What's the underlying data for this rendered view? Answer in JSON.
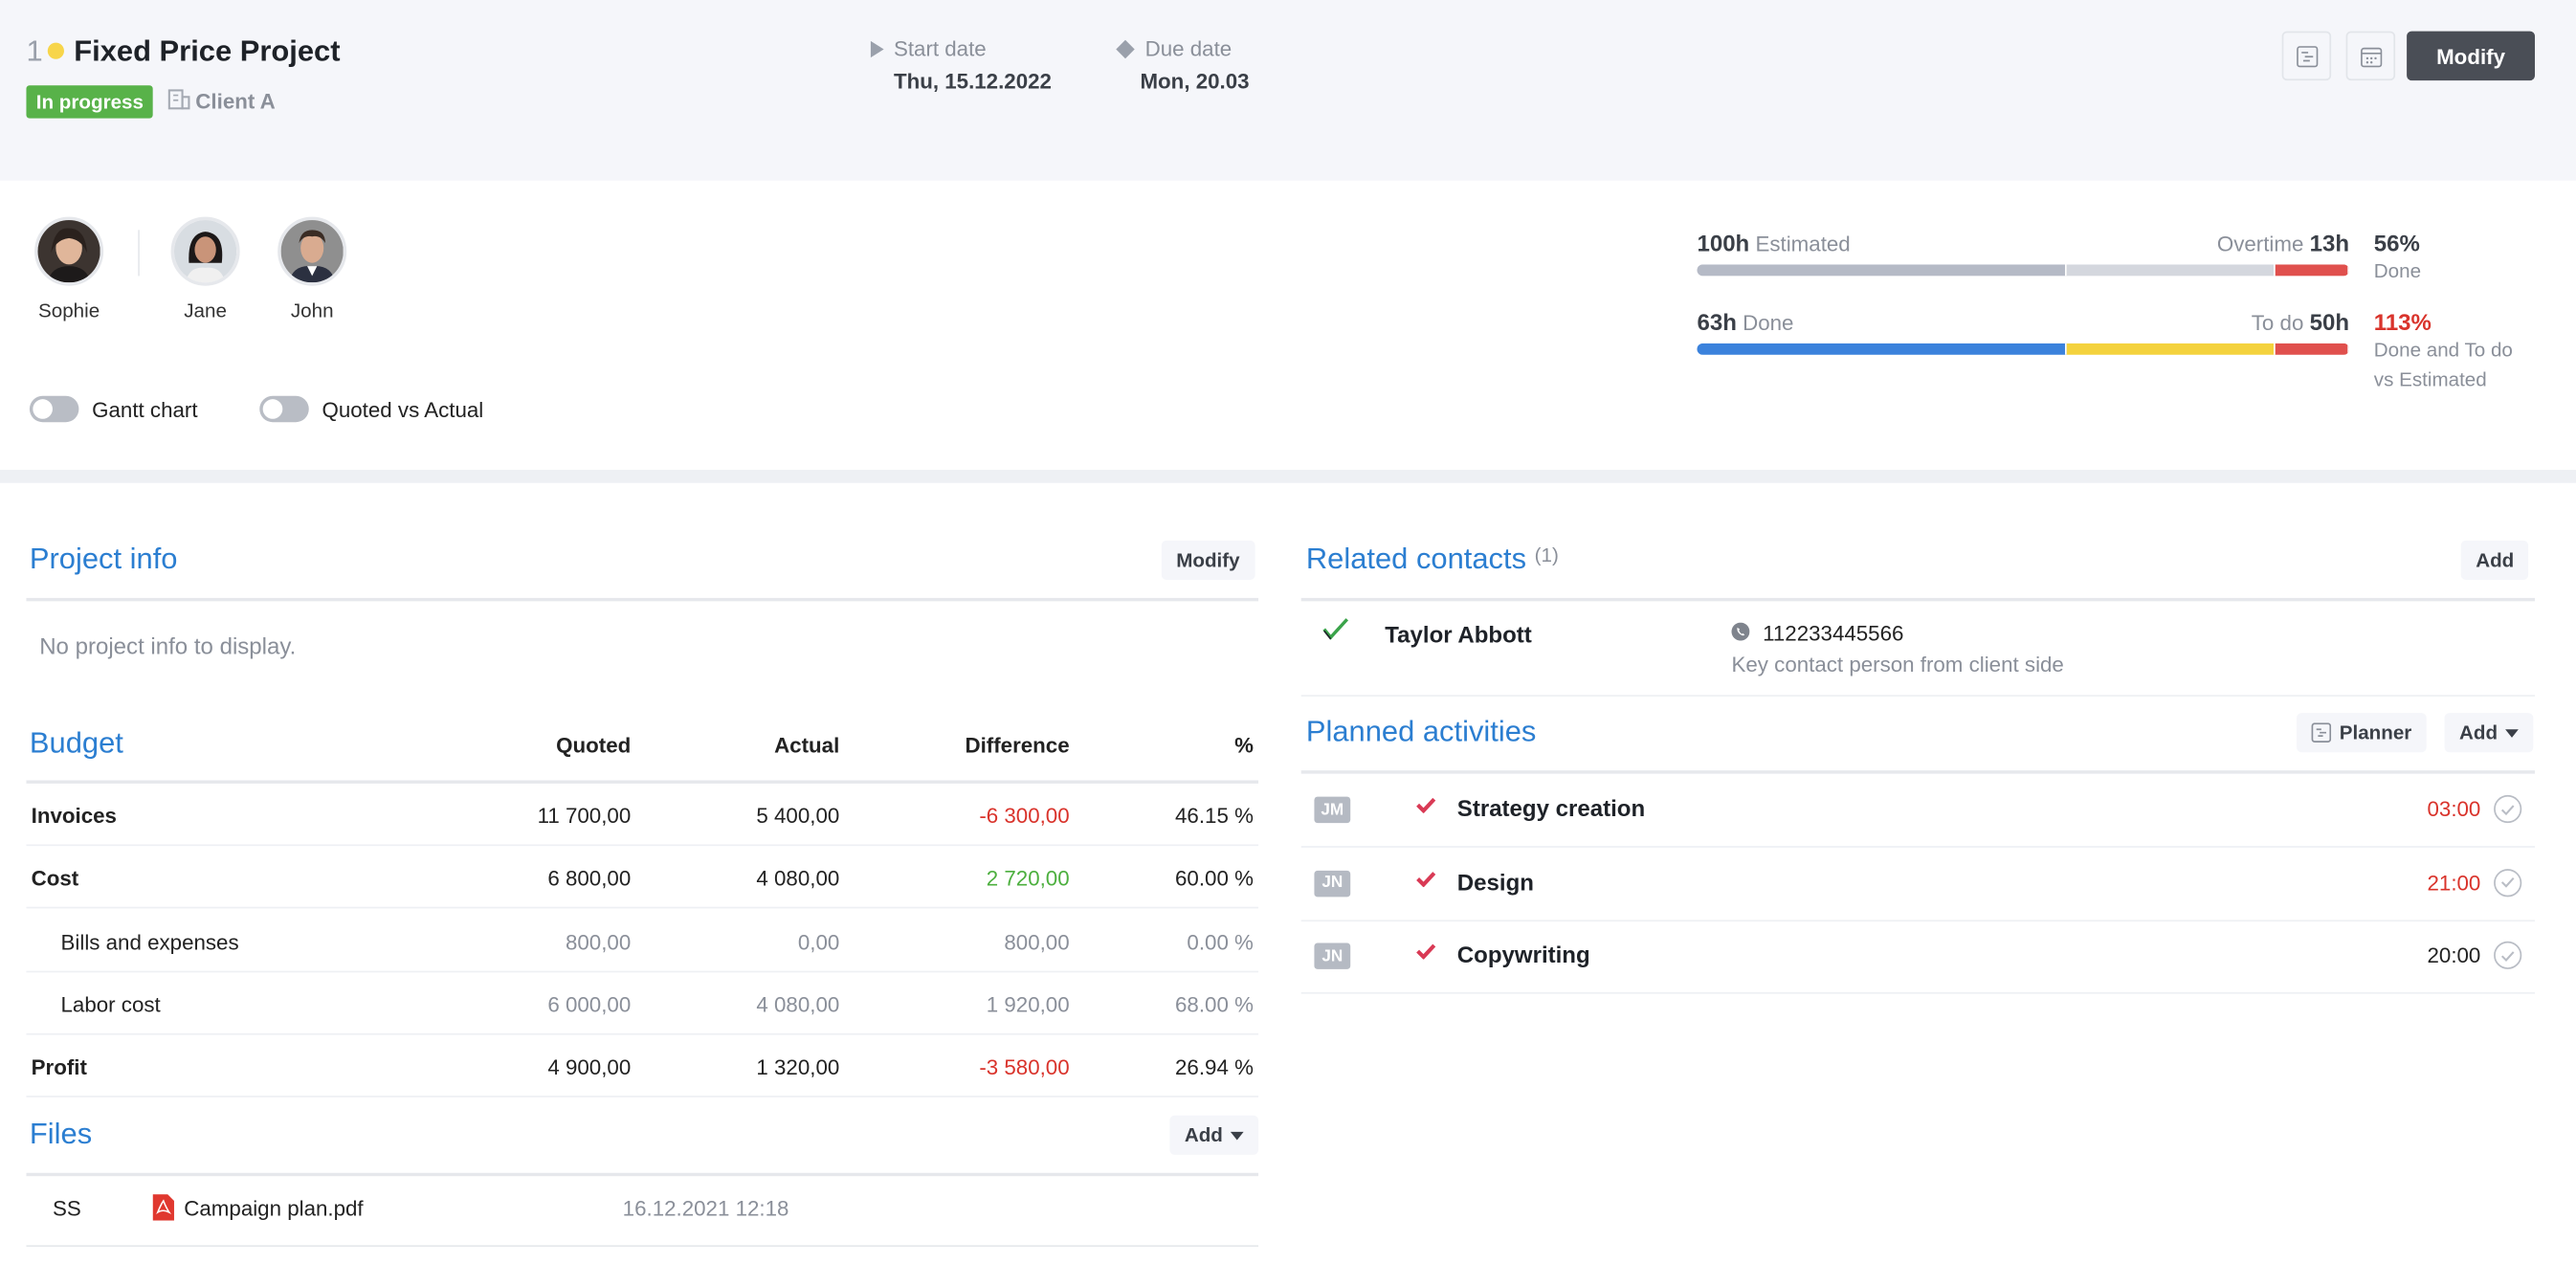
{
  "header": {
    "project_number": "1",
    "project_title": "Fixed Price Project",
    "status": "In progress",
    "client": "Client A",
    "start_label": "Start date",
    "start_value": "Thu, 15.12.2022",
    "due_label": "Due date",
    "due_value": "Mon, 20.03",
    "modify_label": "Modify"
  },
  "team": [
    {
      "name": "Sophie"
    },
    {
      "name": "Jane"
    },
    {
      "name": "John"
    }
  ],
  "toggles": {
    "gantt": "Gantt chart",
    "quoted": "Quoted vs Actual"
  },
  "stats": {
    "estimated_hours": "100h",
    "estimated_label": "Estimated",
    "overtime_label": "Overtime",
    "overtime_hours": "13h",
    "pct_done": "56%",
    "pct_done_label": "Done",
    "done_hours": "63h",
    "done_label": "Done",
    "todo_label": "To do",
    "todo_hours": "50h",
    "pct_total": "113%",
    "pct_total_label_1": "Done and To do",
    "pct_total_label_2": "vs Estimated",
    "bar1": [
      0.566,
      0.32,
      0.114
    ],
    "bar2": [
      0.566,
      0.32,
      0.114
    ],
    "colors": {
      "grey": "#b5bac6",
      "lightgrey": "#d4d7de",
      "red": "#e0504d",
      "blue": "#3b82dc",
      "yellow": "#f4d23e"
    }
  },
  "project_info": {
    "title": "Project info",
    "modify_label": "Modify",
    "empty_text": "No project info to display."
  },
  "budget": {
    "title": "Budget",
    "columns": [
      "Quoted",
      "Actual",
      "Difference",
      "%"
    ],
    "rows": [
      {
        "label": "Invoices",
        "quoted": "11 700,00",
        "actual": "5 400,00",
        "diff": "-6 300,00",
        "pct": "46.15 %",
        "bold": true,
        "diff_color": "red"
      },
      {
        "label": "Cost",
        "quoted": "6 800,00",
        "actual": "4 080,00",
        "diff": "2 720,00",
        "pct": "60.00 %",
        "bold": true,
        "diff_color": "green"
      },
      {
        "label": "Bills and expenses",
        "quoted": "800,00",
        "actual": "0,00",
        "diff": "800,00",
        "pct": "0.00 %",
        "bold": false,
        "diff_color": "grey"
      },
      {
        "label": "Labor cost",
        "quoted": "6 000,00",
        "actual": "4 080,00",
        "diff": "1 920,00",
        "pct": "68.00 %",
        "bold": false,
        "diff_color": "grey"
      },
      {
        "label": "Profit",
        "quoted": "4 900,00",
        "actual": "1 320,00",
        "diff": "-3 580,00",
        "pct": "26.94 %",
        "bold": true,
        "diff_color": "red"
      }
    ]
  },
  "files": {
    "title": "Files",
    "add_label": "Add",
    "items": [
      {
        "initials": "SS",
        "name": "Campaign plan.pdf",
        "date": "16.12.2021 12:18"
      }
    ]
  },
  "contacts": {
    "title": "Related contacts",
    "count": "(1)",
    "add_label": "Add",
    "items": [
      {
        "name": "Taylor Abbott",
        "phone": "112233445566",
        "note": "Key contact person from client side"
      }
    ]
  },
  "activities": {
    "title": "Planned activities",
    "planner_label": "Planner",
    "add_label": "Add",
    "items": [
      {
        "initials": "JM",
        "name": "Strategy creation",
        "time": "03:00",
        "overdue": true
      },
      {
        "initials": "JN",
        "name": "Design",
        "time": "21:00",
        "overdue": true
      },
      {
        "initials": "JN",
        "name": "Copywriting",
        "time": "20:00",
        "overdue": false
      }
    ]
  }
}
